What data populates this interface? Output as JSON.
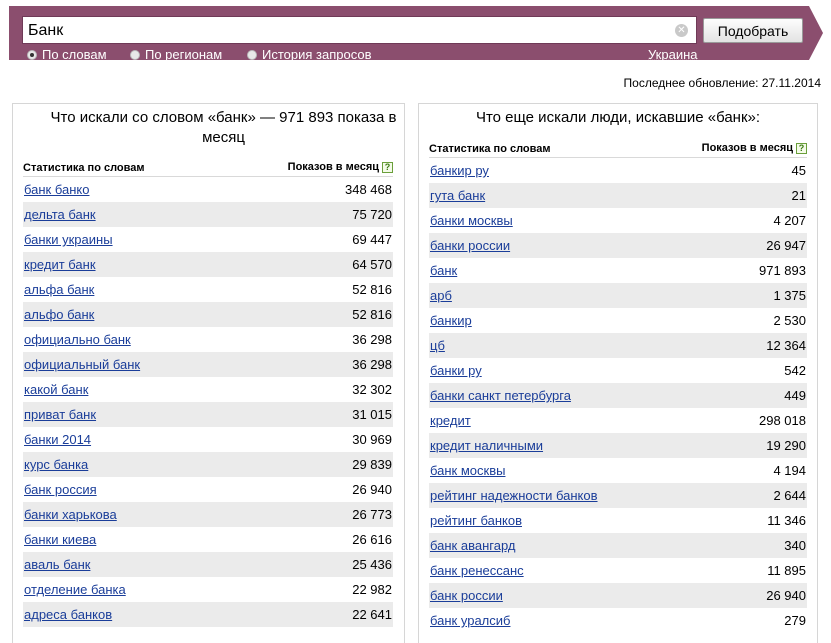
{
  "search": {
    "query": "Банк",
    "submit_label": "Подобрать",
    "modes": [
      {
        "label": "По словам",
        "checked": true
      },
      {
        "label": "По регионам",
        "checked": false
      },
      {
        "label": "История запросов",
        "checked": false
      }
    ],
    "region": "Украина"
  },
  "updated": "Последнее обновление: 27.11.2014",
  "left_panel": {
    "title": "Что искали со словом «банк» — 971 893 показа в месяц",
    "col_keyword": "Статистика по словам",
    "col_count": "Показов в месяц",
    "help_icon": "?",
    "rows": [
      {
        "keyword": "банк банко",
        "count": "348 468"
      },
      {
        "keyword": "дельта банк",
        "count": "75 720"
      },
      {
        "keyword": "банки украины",
        "count": "69 447"
      },
      {
        "keyword": "кредит банк",
        "count": "64 570"
      },
      {
        "keyword": "альфа банк",
        "count": "52 816"
      },
      {
        "keyword": "альфо банк",
        "count": "52 816"
      },
      {
        "keyword": "официально банк",
        "count": "36 298"
      },
      {
        "keyword": "официальный банк",
        "count": "36 298"
      },
      {
        "keyword": "какой банк",
        "count": "32 302"
      },
      {
        "keyword": "приват банк",
        "count": "31 015"
      },
      {
        "keyword": "банки 2014",
        "count": "30 969"
      },
      {
        "keyword": "курс банка",
        "count": "29 839"
      },
      {
        "keyword": "банк россия",
        "count": "26 940"
      },
      {
        "keyword": "банки харькова",
        "count": "26 773"
      },
      {
        "keyword": "банки киева",
        "count": "26 616"
      },
      {
        "keyword": "аваль банк",
        "count": "25 436"
      },
      {
        "keyword": "отделение банка",
        "count": "22 982"
      },
      {
        "keyword": "адреса банков",
        "count": "22 641"
      }
    ]
  },
  "right_panel": {
    "title": "Что еще искали люди, искавшие «банк»:",
    "col_keyword": "Статистика по словам",
    "col_count": "Показов в месяц",
    "help_icon": "?",
    "rows": [
      {
        "keyword": "банкир ру",
        "count": "45"
      },
      {
        "keyword": "гута банк",
        "count": "21"
      },
      {
        "keyword": "банки москвы",
        "count": "4 207"
      },
      {
        "keyword": "банки россии",
        "count": "26 947"
      },
      {
        "keyword": "банк",
        "count": "971 893"
      },
      {
        "keyword": "арб",
        "count": "1 375"
      },
      {
        "keyword": "банкир",
        "count": "2 530"
      },
      {
        "keyword": "цб",
        "count": "12 364"
      },
      {
        "keyword": "банки ру",
        "count": "542"
      },
      {
        "keyword": "банки санкт петербурга",
        "count": "449"
      },
      {
        "keyword": "кредит",
        "count": "298 018"
      },
      {
        "keyword": "кредит наличными",
        "count": "19 290"
      },
      {
        "keyword": "банк москвы",
        "count": "4 194"
      },
      {
        "keyword": "рейтинг надежности банков",
        "count": "2 644"
      },
      {
        "keyword": "рейтинг банков",
        "count": "11 346"
      },
      {
        "keyword": "банк авангард",
        "count": "340"
      },
      {
        "keyword": "банк ренессанс",
        "count": "11 895"
      },
      {
        "keyword": "банк россии",
        "count": "26 940"
      },
      {
        "keyword": "банк уралсиб",
        "count": "279"
      }
    ]
  }
}
